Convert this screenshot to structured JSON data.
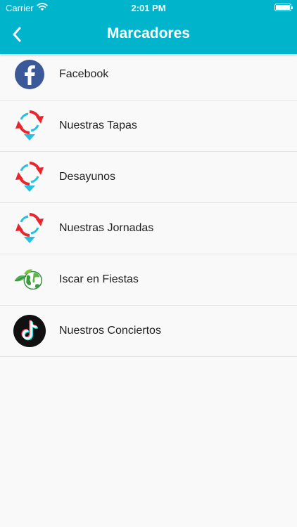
{
  "status_bar": {
    "carrier": "Carrier",
    "time": "2:01 PM",
    "wifi_icon": "wifi-icon",
    "battery_icon": "battery-icon"
  },
  "nav": {
    "title": "Marcadores",
    "back_icon": "chevron-left-icon"
  },
  "colors": {
    "header": "#00b4cc",
    "background": "#f9f9f9",
    "divider": "#e3e3e3",
    "text": "#222222",
    "facebook_blue": "#3b5998",
    "arrow_red": "#e8262d",
    "arrow_cyan": "#24c1e2"
  },
  "items": [
    {
      "label": "Facebook",
      "icon": "facebook-icon"
    },
    {
      "label": "Nuestras Tapas",
      "icon": "refresh-pin-icon"
    },
    {
      "label": "Desayunos",
      "icon": "refresh-pin-icon"
    },
    {
      "label": "Nuestras Jornadas",
      "icon": "refresh-pin-icon"
    },
    {
      "label": "Iscar en Fiestas",
      "icon": "eco-globe-icon"
    },
    {
      "label": "Nuestros Conciertos",
      "icon": "tiktok-icon"
    }
  ]
}
